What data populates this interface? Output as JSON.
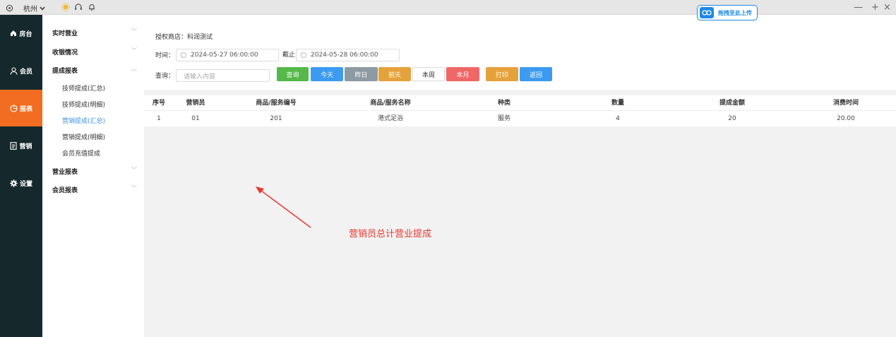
{
  "titlebar": {
    "location": "杭州",
    "upload_label": "拖拽至此上传",
    "win_min": "—",
    "win_max": "+",
    "win_close": "×"
  },
  "nav": {
    "items": [
      {
        "label": "房台",
        "icon": "home-icon"
      },
      {
        "label": "会员",
        "icon": "user-icon"
      },
      {
        "label": "报表",
        "icon": "chart-icon",
        "active": true
      },
      {
        "label": "营销",
        "icon": "document-icon"
      },
      {
        "label": "设置",
        "icon": "gear-icon"
      }
    ]
  },
  "submenu": {
    "groups": [
      {
        "label": "实时营业",
        "chevron": "﹀"
      },
      {
        "label": "收银情况",
        "chevron": "﹀"
      },
      {
        "label": "提成报表",
        "chevron": "︿"
      },
      {
        "label": "营业报表",
        "chevron": "﹀"
      },
      {
        "label": "会员报表",
        "chevron": "﹀"
      }
    ],
    "sub_items": [
      "技师提成(汇总)",
      "技师提成(明细)",
      "营销提成(汇总)",
      "营销提成(明细)",
      "会员充值提成"
    ],
    "active_sub": "营销提成(汇总)"
  },
  "filter": {
    "store_label": "授权商店：科润测试",
    "time_label": "时间：",
    "start_time": "2024-05-27 06:00:00",
    "to_label": "截止",
    "end_time": "2024-05-28 06:00:00",
    "query_label": "查询：",
    "query_placeholder": "请输入内容",
    "buttons": {
      "search": "查询",
      "today": "今天",
      "yesterday": "昨日",
      "day_before": "前天",
      "this_week": "本周",
      "this_month": "本月",
      "print": "打印",
      "back": "返回"
    }
  },
  "table": {
    "headers": [
      "序号",
      "营销员",
      "商品/服务编号",
      "商品/服务名称",
      "种类",
      "数量",
      "提成金额",
      "消费时间"
    ],
    "rows": [
      [
        "1",
        "01",
        "201",
        "港式足浴",
        "服务",
        "4",
        "20",
        "20.00"
      ]
    ]
  },
  "annotation": "营销员总计营业提成",
  "colors": {
    "nav_bg": "#15292c",
    "nav_active": "#f26d21",
    "btn_green": "#55b849",
    "btn_blue": "#3c9bf0",
    "btn_gray": "#8e9aa3",
    "btn_orange": "#e5a23c",
    "btn_red": "#f06767",
    "annotation": "#e8392e"
  }
}
